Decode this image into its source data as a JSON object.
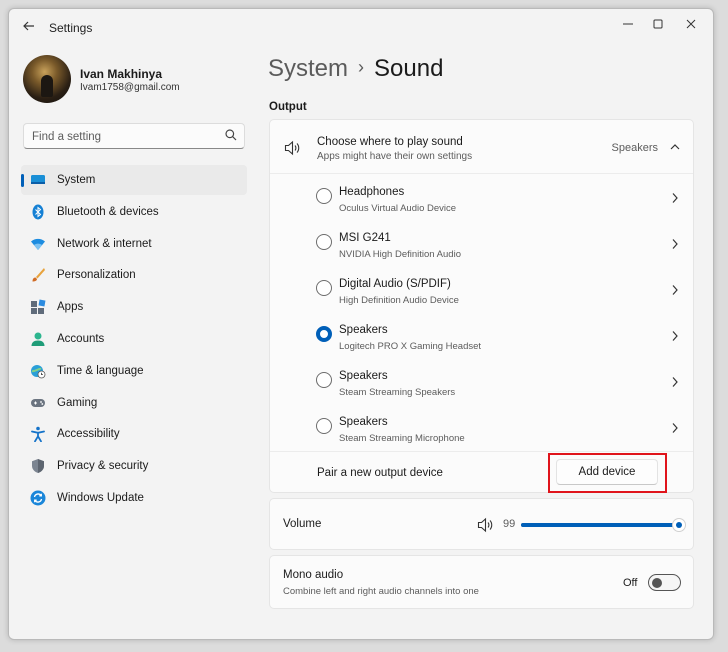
{
  "window": {
    "title": "Settings",
    "back_icon": "arrow-left-icon",
    "controls": [
      "minimize-icon",
      "maximize-icon",
      "close-icon"
    ]
  },
  "profile": {
    "name": "Ivan Makhinya",
    "email": "Ivam1758@gmail.com"
  },
  "search": {
    "placeholder": "Find a setting",
    "icon": "search-icon"
  },
  "sidebar": {
    "items": [
      {
        "label": "System",
        "icon": "system-icon",
        "selected": true
      },
      {
        "label": "Bluetooth & devices",
        "icon": "bluetooth-icon"
      },
      {
        "label": "Network & internet",
        "icon": "wifi-icon"
      },
      {
        "label": "Personalization",
        "icon": "brush-icon"
      },
      {
        "label": "Apps",
        "icon": "apps-icon"
      },
      {
        "label": "Accounts",
        "icon": "accounts-icon"
      },
      {
        "label": "Time & language",
        "icon": "globe-clock-icon"
      },
      {
        "label": "Gaming",
        "icon": "gamepad-icon"
      },
      {
        "label": "Accessibility",
        "icon": "accessibility-icon"
      },
      {
        "label": "Privacy & security",
        "icon": "shield-icon"
      },
      {
        "label": "Windows Update",
        "icon": "windows-update-icon"
      }
    ]
  },
  "breadcrumb": {
    "parent": "System",
    "separator": "›",
    "current": "Sound"
  },
  "output": {
    "section_title": "Output",
    "header": {
      "title": "Choose where to play sound",
      "subtitle": "Apps might have their own settings",
      "selected": "Speakers"
    },
    "devices": [
      {
        "name": "Headphones",
        "desc": "Oculus Virtual Audio Device",
        "selected": false
      },
      {
        "name": "MSI G241",
        "desc": "NVIDIA High Definition Audio",
        "selected": false
      },
      {
        "name": "Digital Audio (S/PDIF)",
        "desc": "High Definition Audio Device",
        "selected": false
      },
      {
        "name": "Speakers",
        "desc": "Logitech PRO X Gaming Headset",
        "selected": true
      },
      {
        "name": "Speakers",
        "desc": "Steam Streaming Speakers",
        "selected": false
      },
      {
        "name": "Speakers",
        "desc": "Steam Streaming Microphone",
        "selected": false
      }
    ],
    "pair_label": "Pair a new output device",
    "add_button": "Add device"
  },
  "volume": {
    "label": "Volume",
    "value": "99",
    "level": 0.99
  },
  "mono": {
    "label": "Mono audio",
    "subtitle": "Combine left and right audio channels into one",
    "state": "Off"
  },
  "colors": {
    "accent": "#005fb8",
    "highlight_box": "#e0141b"
  }
}
